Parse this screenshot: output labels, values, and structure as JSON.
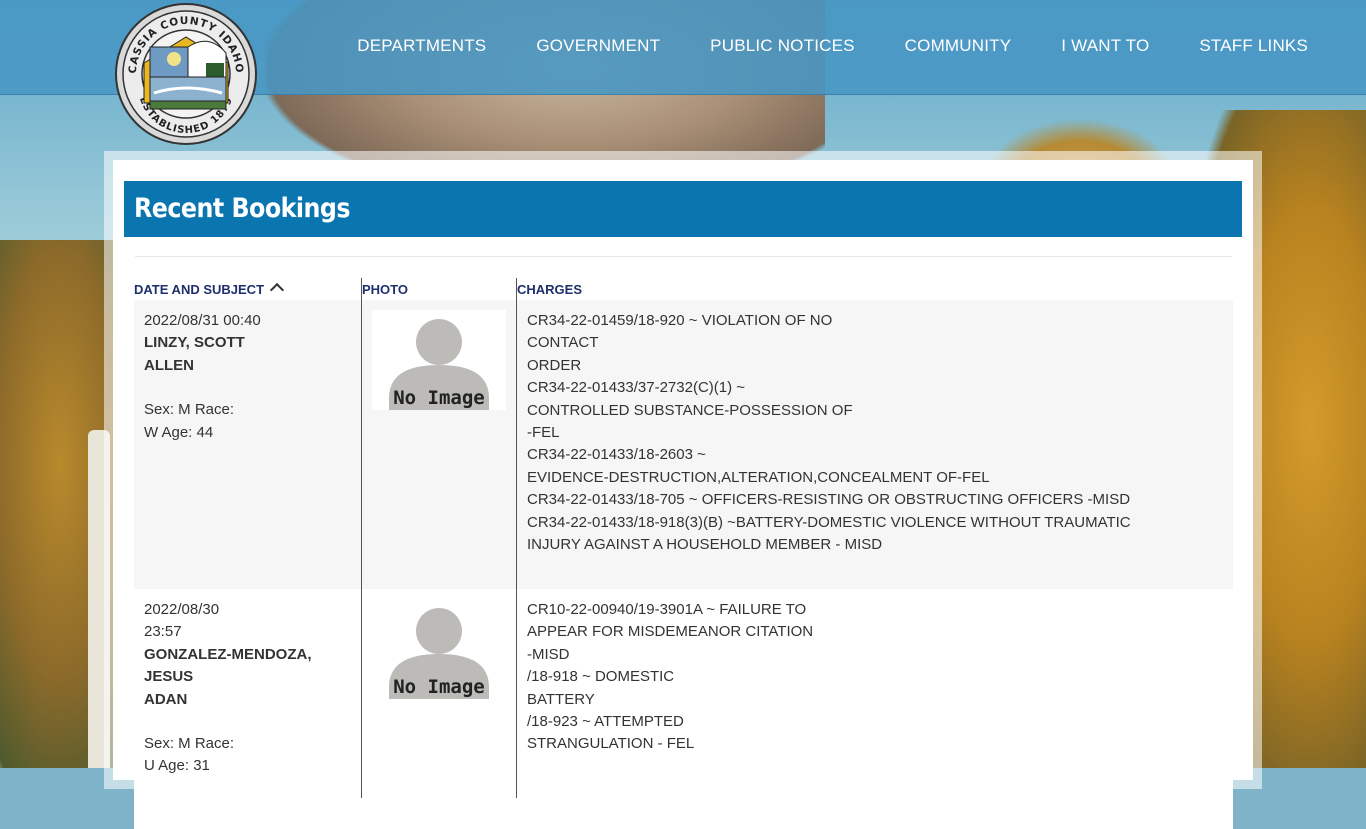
{
  "header": {
    "seal": {
      "top_text": "CASSIA COUNTY IDAHO",
      "bottom_text": "ESTABLISHED 1879"
    },
    "nav": [
      "DEPARTMENTS",
      "GOVERNMENT",
      "PUBLIC NOTICES",
      "COMMUNITY",
      "I WANT TO",
      "STAFF LINKS"
    ]
  },
  "page": {
    "title": "Recent Bookings"
  },
  "table": {
    "headers": {
      "date_subject": "DATE AND SUBJECT",
      "photo": "PHOTO",
      "charges": "CHARGES"
    },
    "rows": [
      {
        "date_lines": [
          "2022/08/31 00:40"
        ],
        "name_lines": [
          "LINZY, SCOTT",
          "ALLEN"
        ],
        "meta_lines": [
          "Sex: M Race:",
          "W Age: 44"
        ],
        "photo_text": "No Image",
        "charges": [
          "CR34-22-01459/18-920 ~ VIOLATION OF NO",
          "CONTACT",
          "ORDER",
          "CR34-22-01433/37-2732(C)(1) ~",
          "CONTROLLED SUBSTANCE-POSSESSION OF",
          "-FEL",
          "CR34-22-01433/18-2603 ~",
          "EVIDENCE-DESTRUCTION,ALTERATION,CONCEALMENT OF-FEL",
          "CR34-22-01433/18-705 ~ OFFICERS-RESISTING OR OBSTRUCTING OFFICERS -MISD",
          "CR34-22-01433/18-918(3)(B) ~BATTERY-DOMESTIC VIOLENCE WITHOUT TRAUMATIC",
          "INJURY AGAINST A HOUSEHOLD MEMBER - MISD"
        ]
      },
      {
        "date_lines": [
          "2022/08/30",
          "23:57"
        ],
        "name_lines": [
          "GONZALEZ-MENDOZA,",
          "JESUS",
          "ADAN"
        ],
        "meta_lines": [
          "Sex: M Race:",
          "U Age: 31"
        ],
        "photo_text": "No Image",
        "charges": [
          "CR10-22-00940/19-3901A ~ FAILURE TO",
          "APPEAR FOR MISDEMEANOR CITATION",
          "-MISD",
          "/18-918 ~ DOMESTIC",
          "BATTERY",
          "/18-923 ~ ATTEMPTED",
          "STRANGULATION - FEL"
        ]
      }
    ]
  }
}
